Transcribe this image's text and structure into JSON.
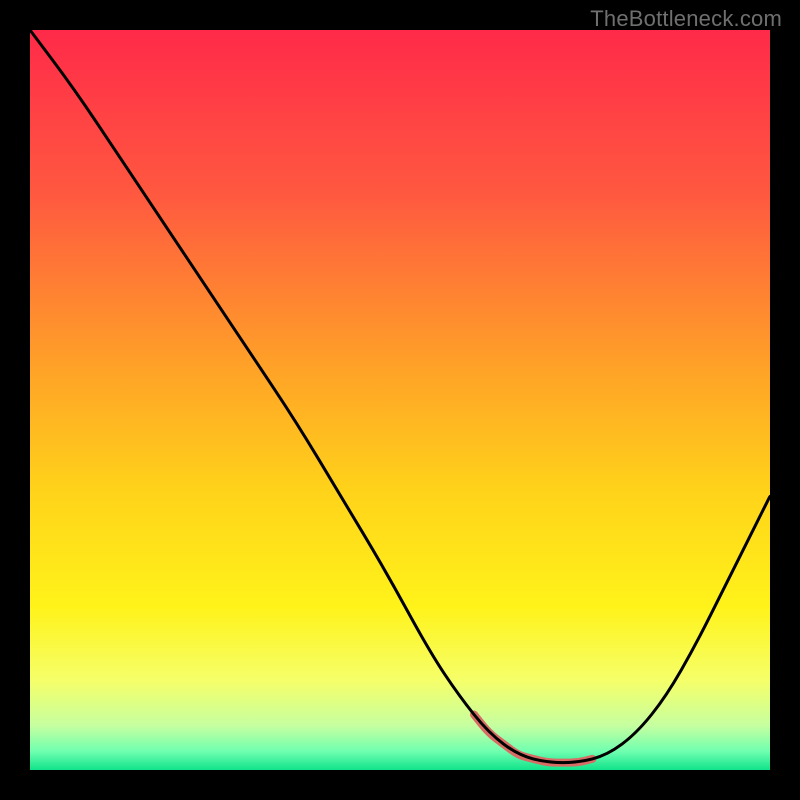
{
  "watermark": "TheBottleneck.com",
  "chart_data": {
    "type": "line",
    "title": "",
    "xlabel": "",
    "ylabel": "",
    "xlim": [
      0,
      100
    ],
    "ylim": [
      0,
      100
    ],
    "grid": false,
    "legend": false,
    "series": [
      {
        "name": "curve",
        "x": [
          0,
          6,
          12,
          18,
          24,
          30,
          36,
          42,
          48,
          54,
          58,
          62,
          66,
          70,
          74,
          78,
          82,
          86,
          90,
          94,
          98,
          100
        ],
        "y": [
          100,
          92,
          83,
          74,
          65,
          56,
          47,
          37,
          27,
          16,
          10,
          5,
          2,
          1,
          1,
          2,
          5,
          10,
          17,
          25,
          33,
          37
        ]
      }
    ],
    "highlight_segment": {
      "x_start": 60,
      "x_end": 76,
      "color": "#d86d66",
      "width": 8
    },
    "gradient_stops": [
      {
        "offset": 0.0,
        "color": "#ff2a49"
      },
      {
        "offset": 0.22,
        "color": "#ff5840"
      },
      {
        "offset": 0.45,
        "color": "#ffa028"
      },
      {
        "offset": 0.62,
        "color": "#ffd21a"
      },
      {
        "offset": 0.78,
        "color": "#fff31a"
      },
      {
        "offset": 0.88,
        "color": "#f5ff6a"
      },
      {
        "offset": 0.94,
        "color": "#c6ffa0"
      },
      {
        "offset": 0.975,
        "color": "#6fffb0"
      },
      {
        "offset": 1.0,
        "color": "#10e38a"
      }
    ]
  }
}
